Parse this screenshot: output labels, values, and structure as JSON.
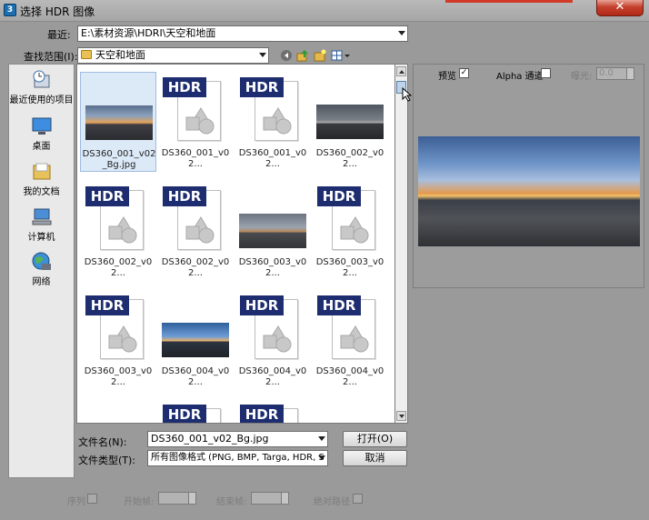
{
  "window": {
    "title": "选择 HDR 图像",
    "close_label": "✕"
  },
  "recent": {
    "label": "最近:",
    "value": "E:\\素材资源\\HDRI\\天空和地面"
  },
  "lookin": {
    "label": "查找范围(I):",
    "value": "天空和地面"
  },
  "places": [
    {
      "label": "最近使用的项目",
      "icon": "recent-places-icon"
    },
    {
      "label": "桌面",
      "icon": "desktop-icon"
    },
    {
      "label": "我的文档",
      "icon": "documents-icon"
    },
    {
      "label": "计算机",
      "icon": "computer-icon"
    },
    {
      "label": "网络",
      "icon": "network-icon"
    }
  ],
  "files": [
    {
      "name": "DS360_001_v02_Bg.jpg",
      "kind": "image",
      "selected": true
    },
    {
      "name": "DS360_001_v02...",
      "kind": "hdr"
    },
    {
      "name": "DS360_001_v02...",
      "kind": "hdr"
    },
    {
      "name": "DS360_002_v02...",
      "kind": "image"
    },
    {
      "name": "DS360_002_v02...",
      "kind": "hdr"
    },
    {
      "name": "DS360_002_v02...",
      "kind": "hdr"
    },
    {
      "name": "DS360_003_v02...",
      "kind": "image"
    },
    {
      "name": "DS360_003_v02...",
      "kind": "hdr"
    },
    {
      "name": "DS360_003_v02...",
      "kind": "hdr"
    },
    {
      "name": "DS360_004_v02...",
      "kind": "image"
    },
    {
      "name": "DS360_004_v02...",
      "kind": "hdr"
    },
    {
      "name": "DS360_004_v02...",
      "kind": "hdr"
    },
    {
      "name": "",
      "kind": "hdr"
    },
    {
      "name": "",
      "kind": "hdr"
    }
  ],
  "hdr_badge": "HDR",
  "filename": {
    "label": "文件名(N):",
    "value": "DS360_001_v02_Bg.jpg"
  },
  "filetype": {
    "label": "文件类型(T):",
    "value": "所有图像格式 (PNG, BMP, Targa, HDR, S"
  },
  "buttons": {
    "open": "打开(O)",
    "cancel": "取消"
  },
  "preview": {
    "preview_label": "预览",
    "preview_checked": "✓",
    "alpha_label": "Alpha 通道",
    "exposure_label": "曝光:",
    "exposure_value": "0.0"
  },
  "sequence": {
    "seq_label": "序列",
    "start_label": "开始帧:",
    "end_label": "结束帧:",
    "abs_label": "绝对路径"
  }
}
